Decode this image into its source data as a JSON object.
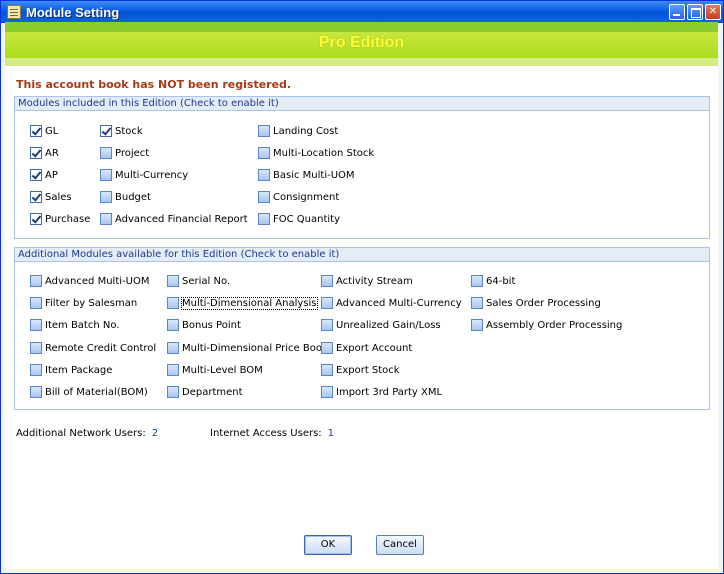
{
  "window": {
    "title": "Module Setting",
    "buttons": [
      "minimize-icon",
      "maximize-icon",
      "close-icon"
    ]
  },
  "banner": {
    "title": "Pro Edition"
  },
  "warning": "This account book has NOT been registered.",
  "included_group": {
    "header": "Modules included in this Edition (Check to enable it)",
    "items": [
      {
        "label": "GL",
        "checked": true
      },
      {
        "label": "AR",
        "checked": true
      },
      {
        "label": "AP",
        "checked": true
      },
      {
        "label": "Sales",
        "checked": true
      },
      {
        "label": "Purchase",
        "checked": true
      },
      {
        "label": "Stock",
        "checked": true
      },
      {
        "label": "Project",
        "checked": false
      },
      {
        "label": "Multi-Currency",
        "checked": false
      },
      {
        "label": "Budget",
        "checked": false
      },
      {
        "label": "Advanced Financial Report",
        "checked": false
      },
      {
        "label": "Landing Cost",
        "checked": false
      },
      {
        "label": "Multi-Location Stock",
        "checked": false
      },
      {
        "label": "Basic Multi-UOM",
        "checked": false
      },
      {
        "label": "Consignment",
        "checked": false
      },
      {
        "label": "FOC Quantity",
        "checked": false
      }
    ]
  },
  "additional_group": {
    "header": "Additional Modules available for this Edition (Check to enable it)",
    "items": [
      {
        "label": "Advanced Multi-UOM",
        "checked": false
      },
      {
        "label": "Filter by Salesman",
        "checked": false
      },
      {
        "label": "Item Batch No.",
        "checked": false
      },
      {
        "label": "Remote Credit Control",
        "checked": false
      },
      {
        "label": "Item Package",
        "checked": false
      },
      {
        "label": "Bill of Material(BOM)",
        "checked": false
      },
      {
        "label": "Serial No.",
        "checked": false
      },
      {
        "label": "Multi-Dimensional Analysis",
        "checked": false,
        "focused": true
      },
      {
        "label": "Bonus Point",
        "checked": false
      },
      {
        "label": "Multi-Dimensional Price Book",
        "checked": false
      },
      {
        "label": "Multi-Level BOM",
        "checked": false
      },
      {
        "label": "Department",
        "checked": false
      },
      {
        "label": "Activity Stream",
        "checked": false
      },
      {
        "label": "Advanced Multi-Currency",
        "checked": false
      },
      {
        "label": "Unrealized Gain/Loss",
        "checked": false
      },
      {
        "label": "Export Account",
        "checked": false
      },
      {
        "label": "Export Stock",
        "checked": false
      },
      {
        "label": "Import 3rd Party XML",
        "checked": false
      },
      {
        "label": "64-bit",
        "checked": false
      },
      {
        "label": "Sales Order Processing",
        "checked": false
      },
      {
        "label": "Assembly Order Processing",
        "checked": false
      }
    ]
  },
  "network_users": {
    "label": "Additional Network Users:",
    "value": "2"
  },
  "internet_users": {
    "label": "Internet Access Users:",
    "value": "1"
  },
  "actions": {
    "ok": "OK",
    "cancel": "Cancel"
  }
}
